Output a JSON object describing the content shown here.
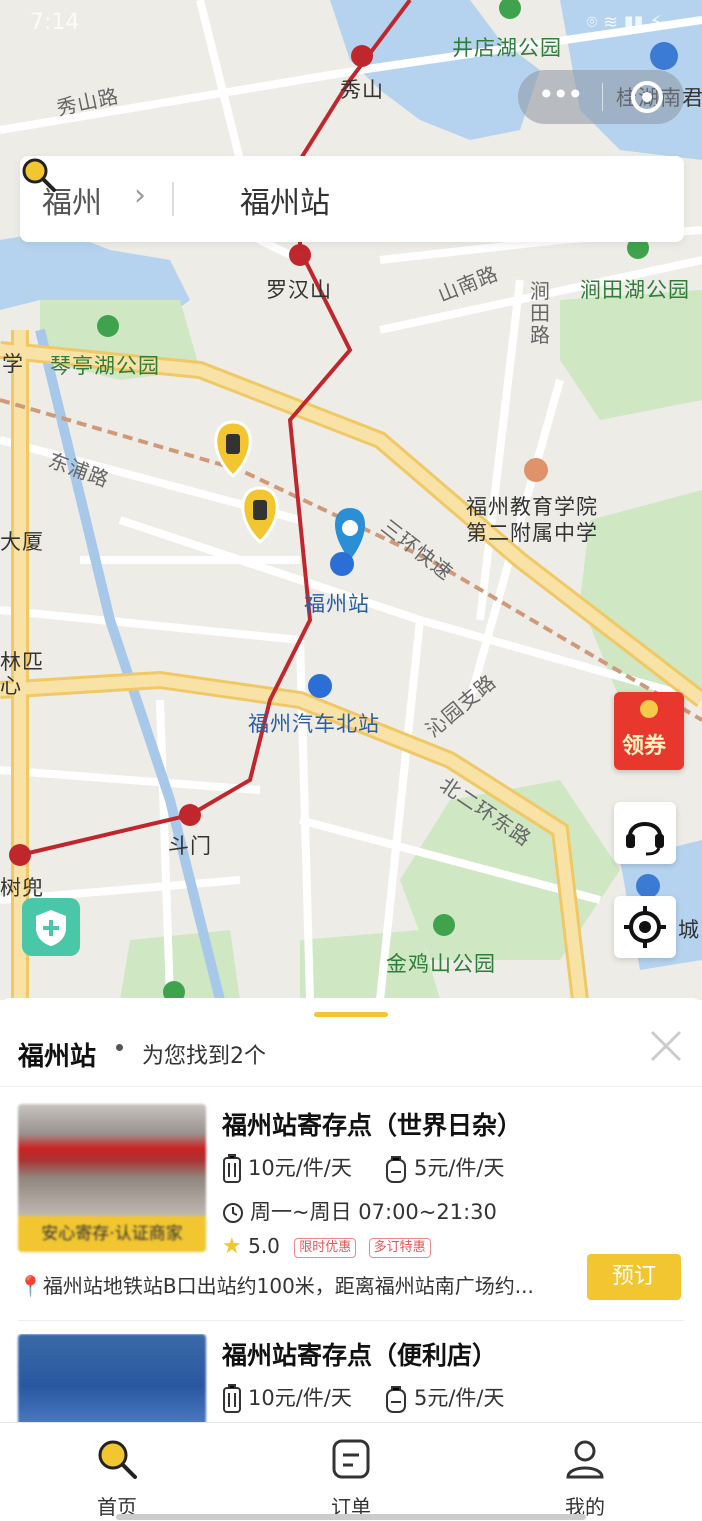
{
  "status_bar": {
    "time": "7:14"
  },
  "map": {
    "labels": {
      "xiushan_road": "秀山路",
      "xiushan": "秀山",
      "jingdian_park": "井店湖公园",
      "guihu": "桂湖南君",
      "luohanshan": "罗汉山",
      "shannan_road": "山南路",
      "jiantian_road": "涧田路",
      "jiantian_park": "涧田湖公园",
      "xue": "学",
      "qinting_park": "琴亭湖公园",
      "dongpu_road": "东浦路",
      "dasha": "大厦",
      "school": "福州教育学院\n第二附属中学",
      "sanhuan": "三环快速",
      "fuzhou_station": "福州站",
      "linpi": "林匹\n心",
      "bus_station": "福州汽车北站",
      "qinyuan_road": "沁园支路",
      "beierhuan": "北二环东路",
      "doumen": "斗门",
      "shudou": "树兜",
      "jinjishan_park": "金鸡山公园",
      "cheng": "城"
    },
    "coupon_label": "领券"
  },
  "search": {
    "city": "福州",
    "value": "福州站"
  },
  "sheet": {
    "title": "福州站",
    "subtitle": "为您找到2个"
  },
  "stores": [
    {
      "name": "福州站寄存点（世界日杂）",
      "badge": "安心寄存·认证商家",
      "price_large": "10元/件/天",
      "price_small": "5元/件/天",
      "hours": "周一~周日 07:00~21:30",
      "rating": "5.0",
      "tags": [
        "限时优惠",
        "多订特惠"
      ],
      "address": "福州站地铁站B口出站约100米，距离福州站南广场约...",
      "book_label": "预订"
    },
    {
      "name": "福州站寄存点（便利店）",
      "price_large": "10元/件/天",
      "price_small": "5元/件/天"
    }
  ],
  "tabbar": {
    "home": "首页",
    "orders": "订单",
    "mine": "我的"
  },
  "colors": {
    "accent": "#f2c631",
    "metro_line": "#c0272d",
    "map_bg": "#eeece6",
    "water": "#b5d3ef",
    "green": "#cfe7c3",
    "highway": "#f5d585",
    "pin": "#2b8fd6"
  }
}
